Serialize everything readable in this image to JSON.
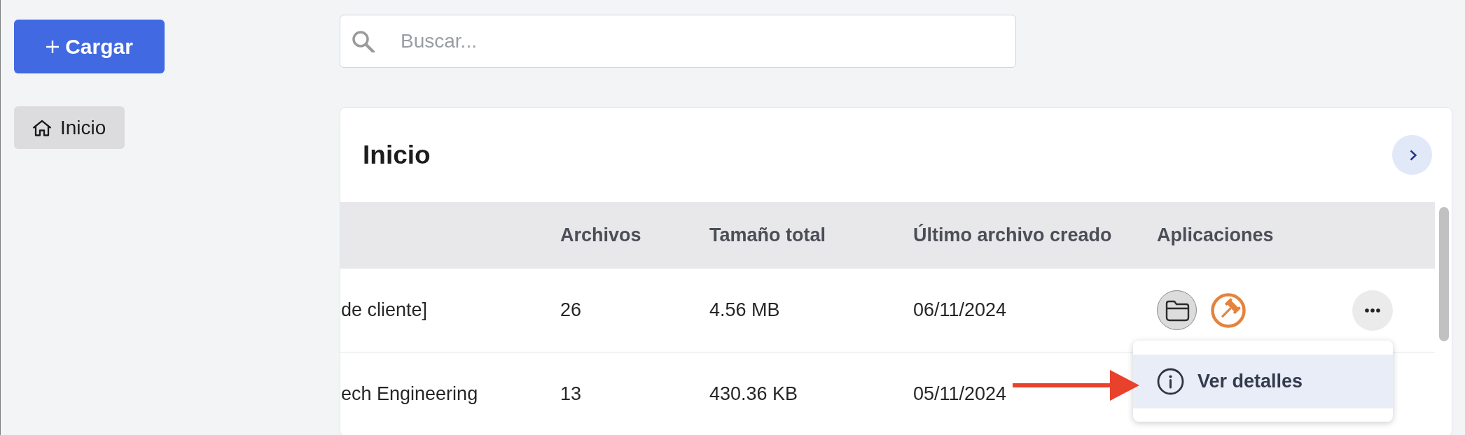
{
  "sidebar": {
    "upload_button": {
      "label": "Cargar"
    },
    "items": [
      {
        "label": "Inicio",
        "selected": true
      }
    ]
  },
  "search": {
    "placeholder": "Buscar..."
  },
  "panel": {
    "title": "Inicio"
  },
  "table": {
    "columns": [
      "Archivos",
      "Tamaño total",
      "Último archivo creado",
      "Aplicaciones"
    ],
    "rows": [
      {
        "column_1": "de cliente]",
        "files": "26",
        "total_size": "4.56 MB",
        "last_file_created": "06/11/2024",
        "apps": [
          {
            "kind": "folder"
          },
          {
            "kind": "gavel"
          }
        ],
        "more_button": true,
        "menu": {
          "items": [
            {
              "label": "Ver detalles",
              "selected": true
            }
          ]
        }
      },
      {
        "column_1": "ech Engineering",
        "files": "13",
        "total_size": "430.36 KB",
        "last_file_created": "05/11/2024"
      }
    ]
  }
}
